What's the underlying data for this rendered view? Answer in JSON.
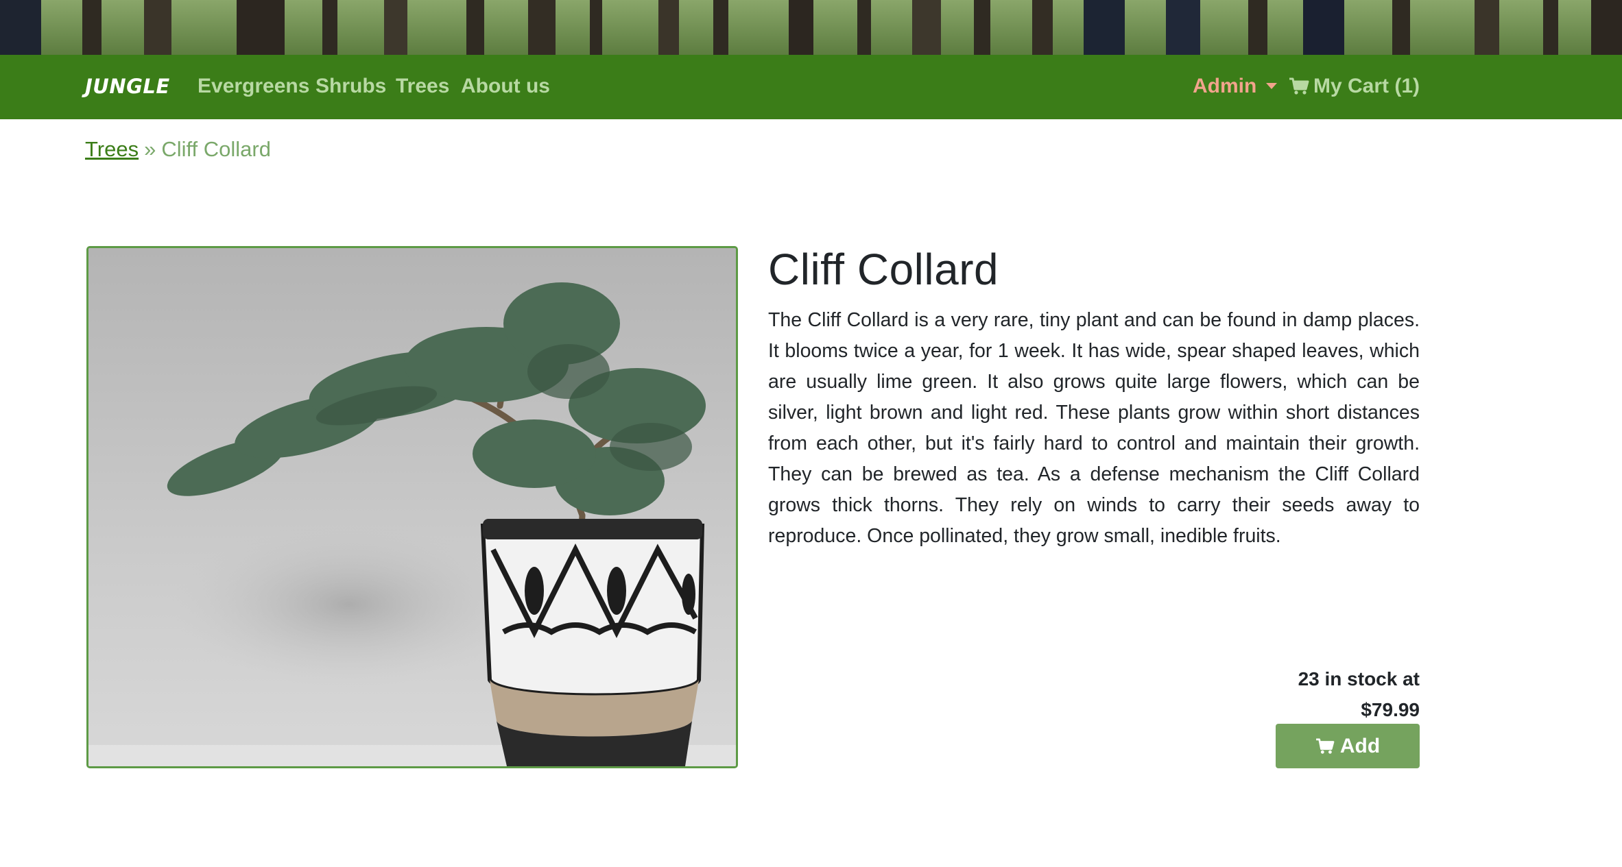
{
  "navbar": {
    "brand": "JUNGLE",
    "links": [
      "Evergreens",
      "Shrubs",
      "Trees",
      "About us"
    ],
    "admin_label": "Admin",
    "cart_label": "My Cart (1)"
  },
  "breadcrumb": {
    "parent": "Trees",
    "separator": "»",
    "current": "Cliff Collard"
  },
  "product": {
    "name": "Cliff Collard",
    "description": "The Cliff Collard is a very rare, tiny plant and can be found in damp places. It blooms twice a year, for 1 week. It has wide, spear shaped leaves, which are usually lime green. It also grows quite large flowers, which can be silver, light brown and light red. These plants grow within short distances from each other, but it's fairly hard to control and maintain their growth. They can be brewed as tea. As a defense mechanism the Cliff Collard grows thick thorns. They rely on winds to carry their seeds away to reproduce. Once pollinated, they grow small, inedible fruits.",
    "stock_line": "23 in stock at",
    "price": "$79.99",
    "add_label": "Add"
  },
  "colors": {
    "navbar": "#3b7d18",
    "nav_link": "#b8d9a3",
    "admin": "#f2a48d",
    "button": "#75a35e"
  },
  "icons": [
    "cart-icon",
    "caret-down-icon"
  ]
}
